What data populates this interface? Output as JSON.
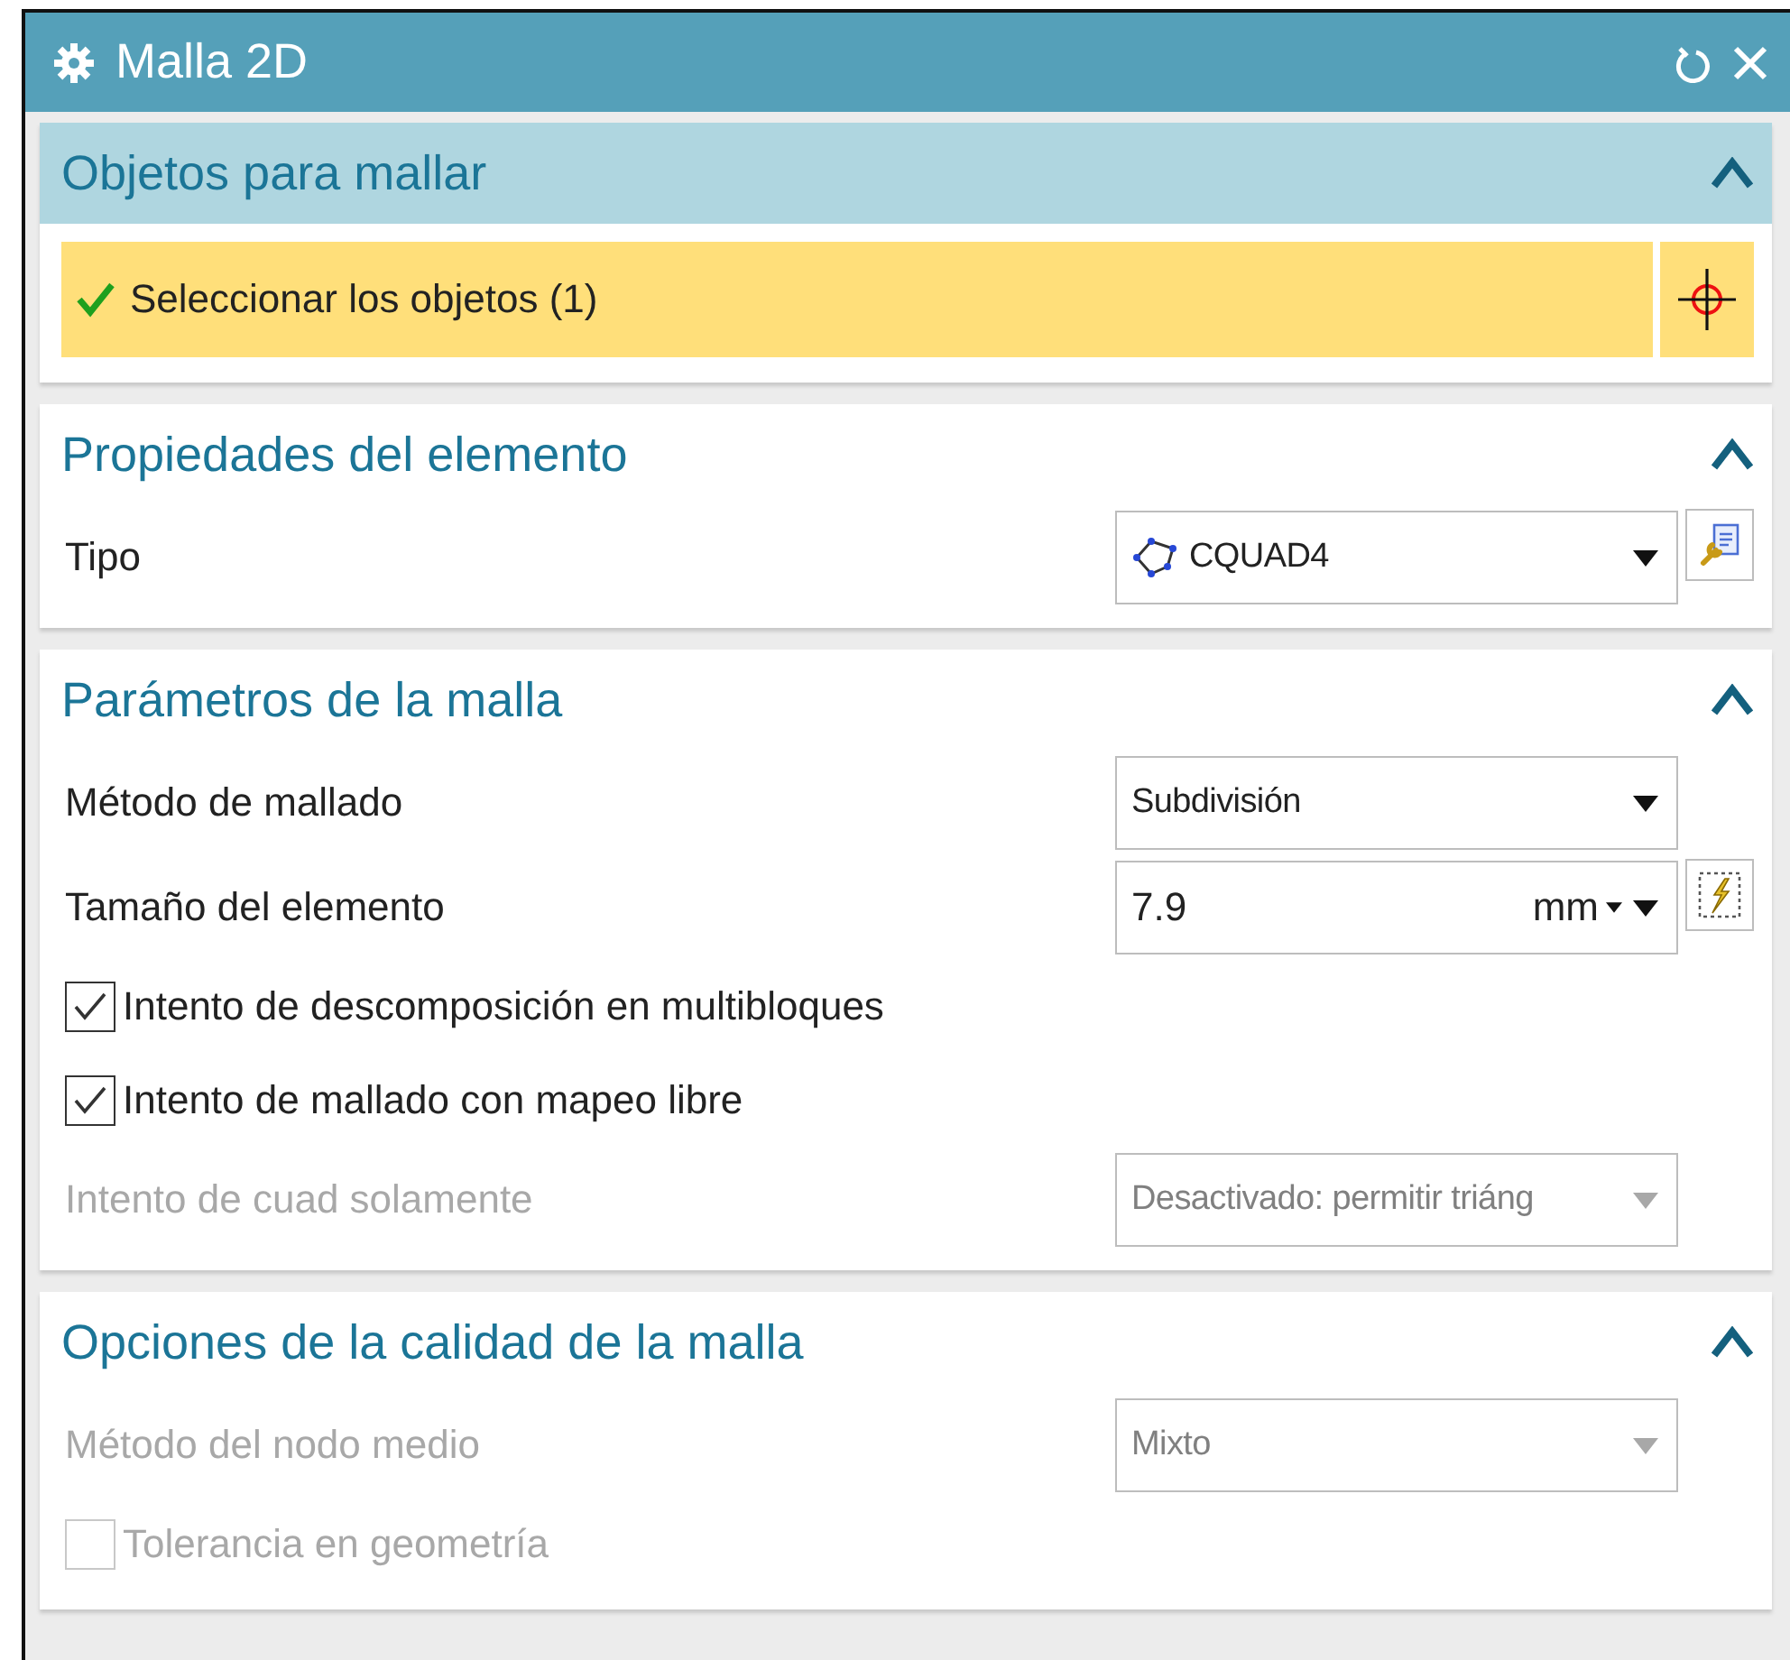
{
  "window": {
    "title": "Malla 2D"
  },
  "sections": [
    {
      "title": "Objetos para mallar",
      "active": true,
      "expanded": true,
      "rows": [
        {
          "kind": "selection",
          "label": "Seleccionar los objetos (1)",
          "done": true
        }
      ]
    },
    {
      "title": "Propiedades del elemento",
      "active": false,
      "expanded": true,
      "rows": [
        {
          "kind": "select",
          "label": "Tipo",
          "value": "CQUAD4",
          "icon": true,
          "button": true,
          "disabled": false
        }
      ]
    },
    {
      "title": "Parámetros de la malla",
      "active": false,
      "expanded": true,
      "rows": [
        {
          "kind": "select",
          "label": "Método de mallado",
          "value": "Subdivisión",
          "icon": false,
          "button": false,
          "disabled": false
        },
        {
          "kind": "measure",
          "label": "Tamaño del elemento",
          "value": "7.9",
          "unit": "mm",
          "button": true
        },
        {
          "kind": "checkbox",
          "label": "Intento de descomposición en multibloques",
          "checked": true,
          "disabled": false
        },
        {
          "kind": "checkbox",
          "label": "Intento de mallado con mapeo libre",
          "checked": true,
          "disabled": false
        },
        {
          "kind": "select",
          "label": "Intento de cuad solamente",
          "value": "Desactivado: permitir triáng",
          "icon": false,
          "button": false,
          "disabled": true
        }
      ]
    },
    {
      "title": "Opciones de la calidad de la malla",
      "active": false,
      "expanded": true,
      "rows": [
        {
          "kind": "select",
          "label": "Método del nodo medio",
          "value": "Mixto",
          "icon": false,
          "button": false,
          "disabled": true
        },
        {
          "kind": "checkbox",
          "label": "Tolerancia en geometría",
          "checked": false,
          "disabled": true
        }
      ]
    }
  ]
}
